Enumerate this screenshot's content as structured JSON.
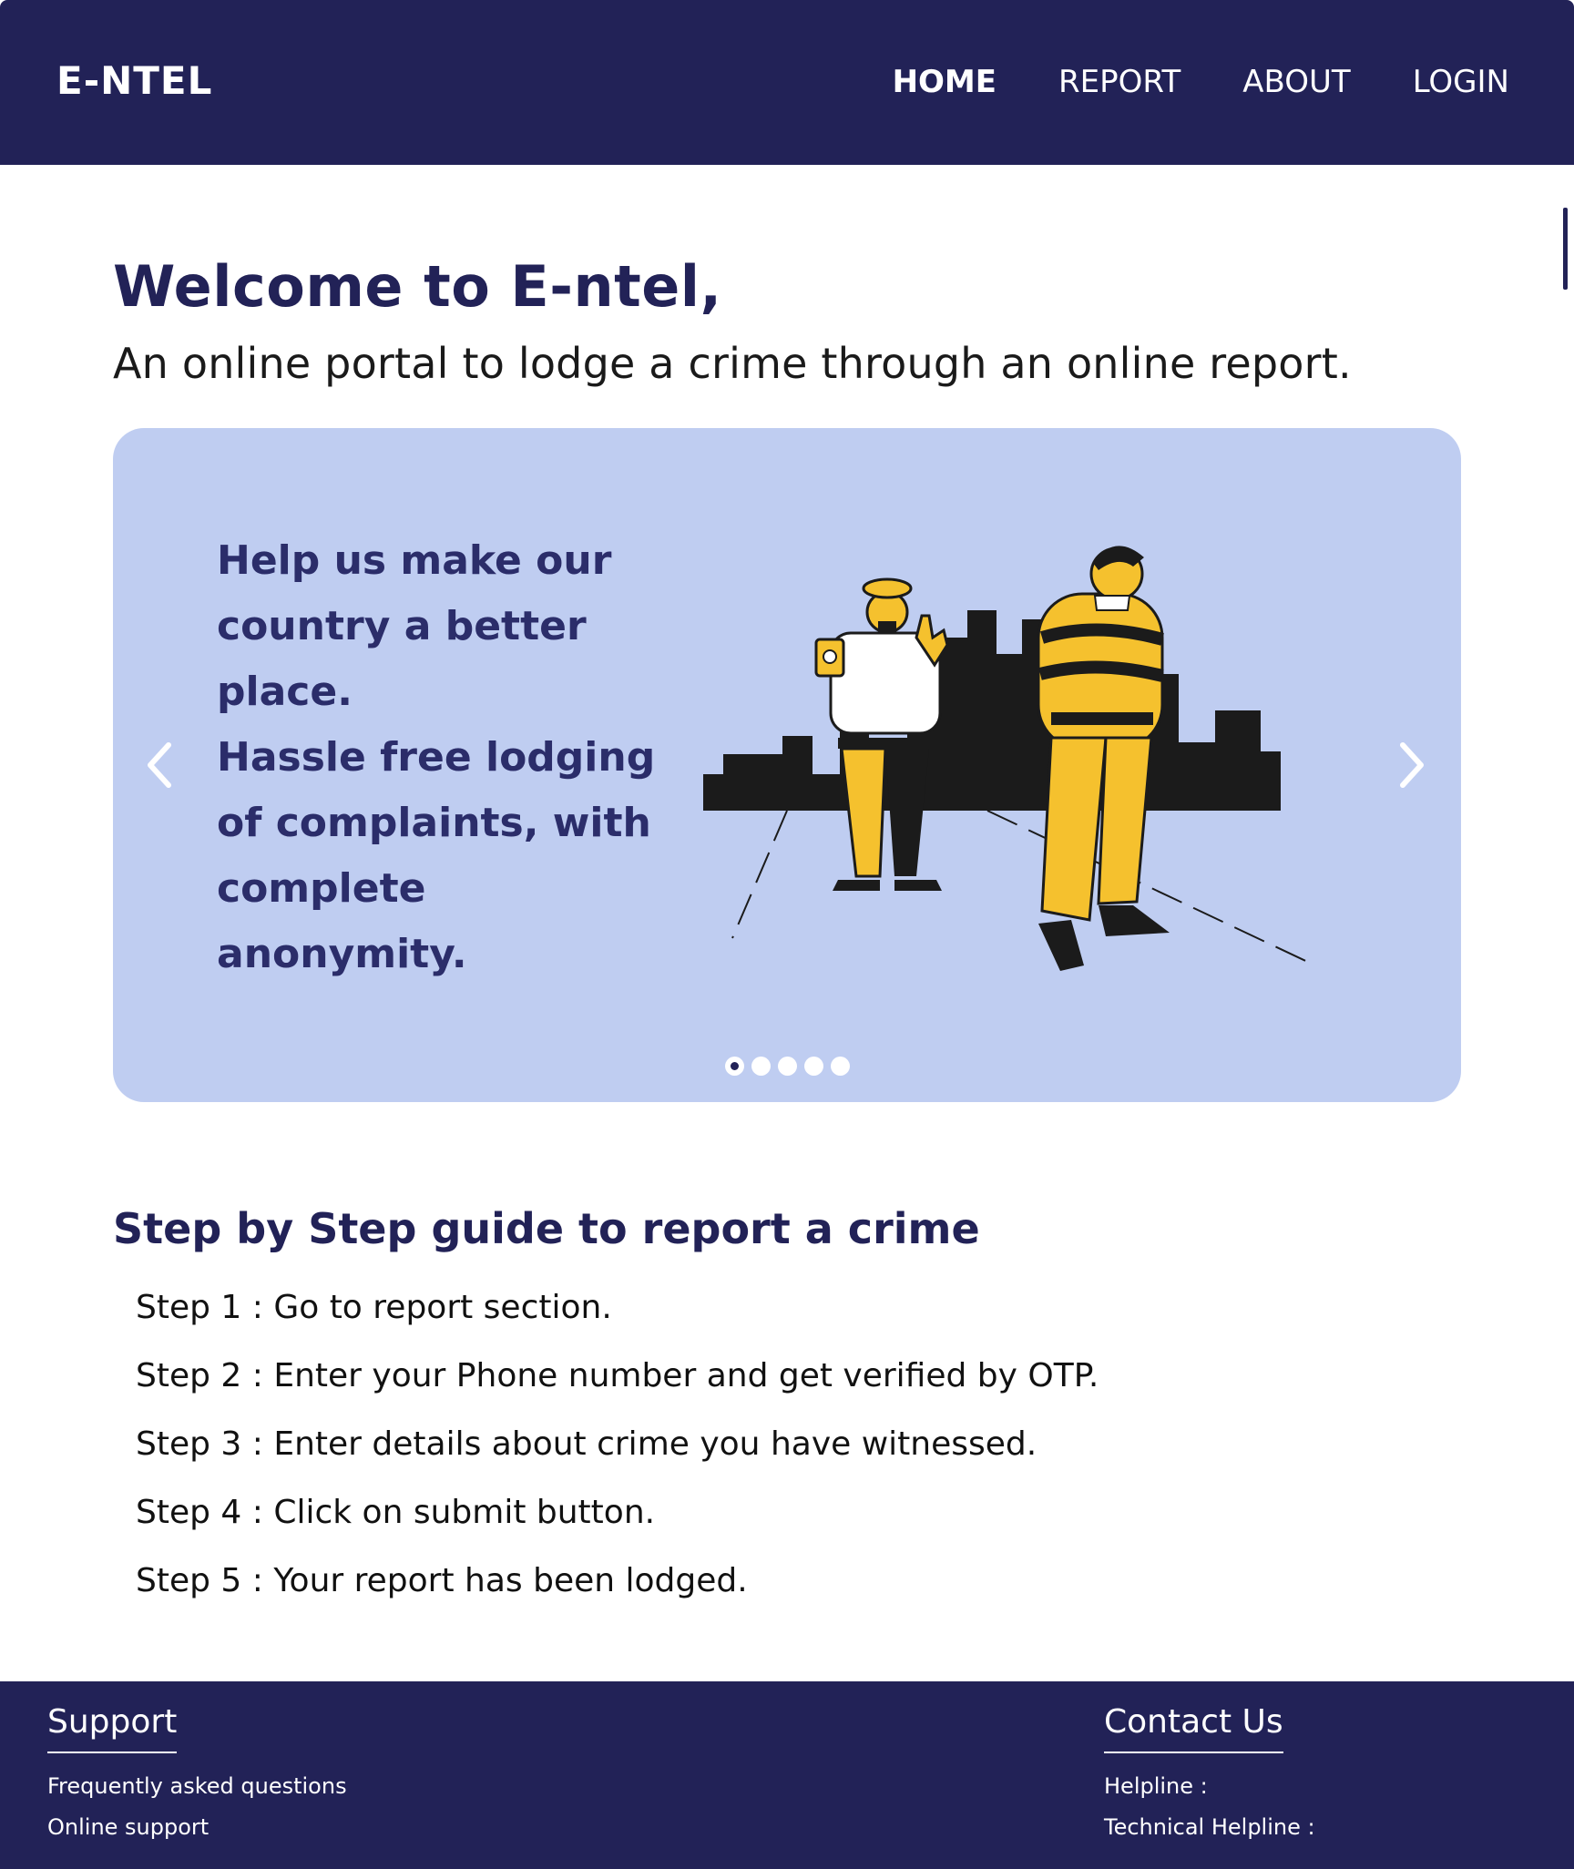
{
  "header": {
    "logo": "E-NTEL",
    "nav": [
      {
        "label": "HOME",
        "active": true
      },
      {
        "label": "REPORT"
      },
      {
        "label": "ABOUT"
      },
      {
        "label": "LOGIN"
      }
    ]
  },
  "hero": {
    "title": "Welcome to E-ntel,",
    "subtitle": "An online portal to lodge a crime through an online report."
  },
  "carousel": {
    "lines": [
      "Help us make our",
      "country a better",
      "place.",
      "Hassle free lodging",
      "of complaints, with",
      "complete",
      "anonymity."
    ],
    "slide_count": 5,
    "active_slide": 1
  },
  "guide": {
    "title": "Step by Step guide to report a crime",
    "steps": [
      "Step 1 : Go to report section.",
      "Step 2 : Enter your Phone number and get verified by OTP.",
      "Step 3 : Enter details about crime you have witnessed.",
      "Step 4 : Click on submit button.",
      "Step 5 : Your report has been lodged."
    ]
  },
  "footer": {
    "support": {
      "heading": "Support",
      "links": [
        "Frequently asked questions",
        "Online support"
      ]
    },
    "contact": {
      "heading": "Contact Us",
      "links": [
        "Helpline :",
        "Technical Helpline :"
      ]
    }
  },
  "colors": {
    "navy": "#222257",
    "carousel_bg": "#bfcdf1",
    "carousel_text": "#2b2d6a",
    "accent_yellow": "#f5c12e"
  },
  "icons": {
    "prev": "chevron-left-icon",
    "next": "chevron-right-icon"
  }
}
